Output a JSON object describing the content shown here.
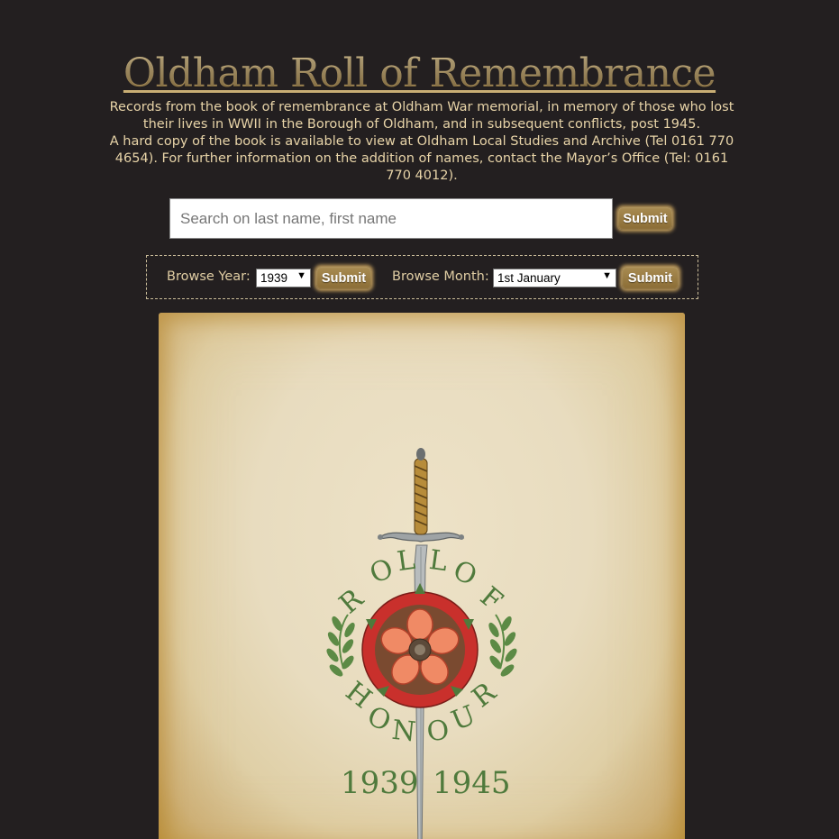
{
  "page": {
    "title": "Oldham Roll of Remembrance",
    "intro_line1": "Records from the book of remembrance at Oldham War memorial, in memory of those who lost their lives in WWII in the Borough of Oldham, and in subsequent conflicts, post 1945.",
    "intro_line2": "A hard copy of the book is available to view at Oldham Local Studies and Archive (Tel 0161 770 4654). For further information on the addition of names, contact the Mayor’s Office (Tel: 0161 770 4012)."
  },
  "search": {
    "placeholder": "Search on last name, first name",
    "value": "",
    "submit_label": "Submit"
  },
  "browse": {
    "year_label": "Browse Year:",
    "year_value": "1939",
    "year_submit": "Submit",
    "month_label": "Browse Month:",
    "month_value": "1st January",
    "month_submit": "Submit"
  },
  "cover": {
    "top_text_letters": [
      "R",
      "O",
      "L",
      "L",
      "O",
      "F"
    ],
    "bottom_text_letters": [
      "H",
      "O",
      "N",
      "O",
      "U",
      "R"
    ],
    "year_left": "1939",
    "year_right": "1945"
  },
  "colors": {
    "background": "#231f20",
    "accent_gold": "#b59a62",
    "text": "#e8d4a8",
    "cover_green": "#4f7a3c",
    "rose_red": "#c9302c"
  },
  "icons": {
    "select_arrow": "triangle-down-icon",
    "sword": "sword-icon",
    "rose": "tudor-rose-icon",
    "laurel": "laurel-icon"
  }
}
